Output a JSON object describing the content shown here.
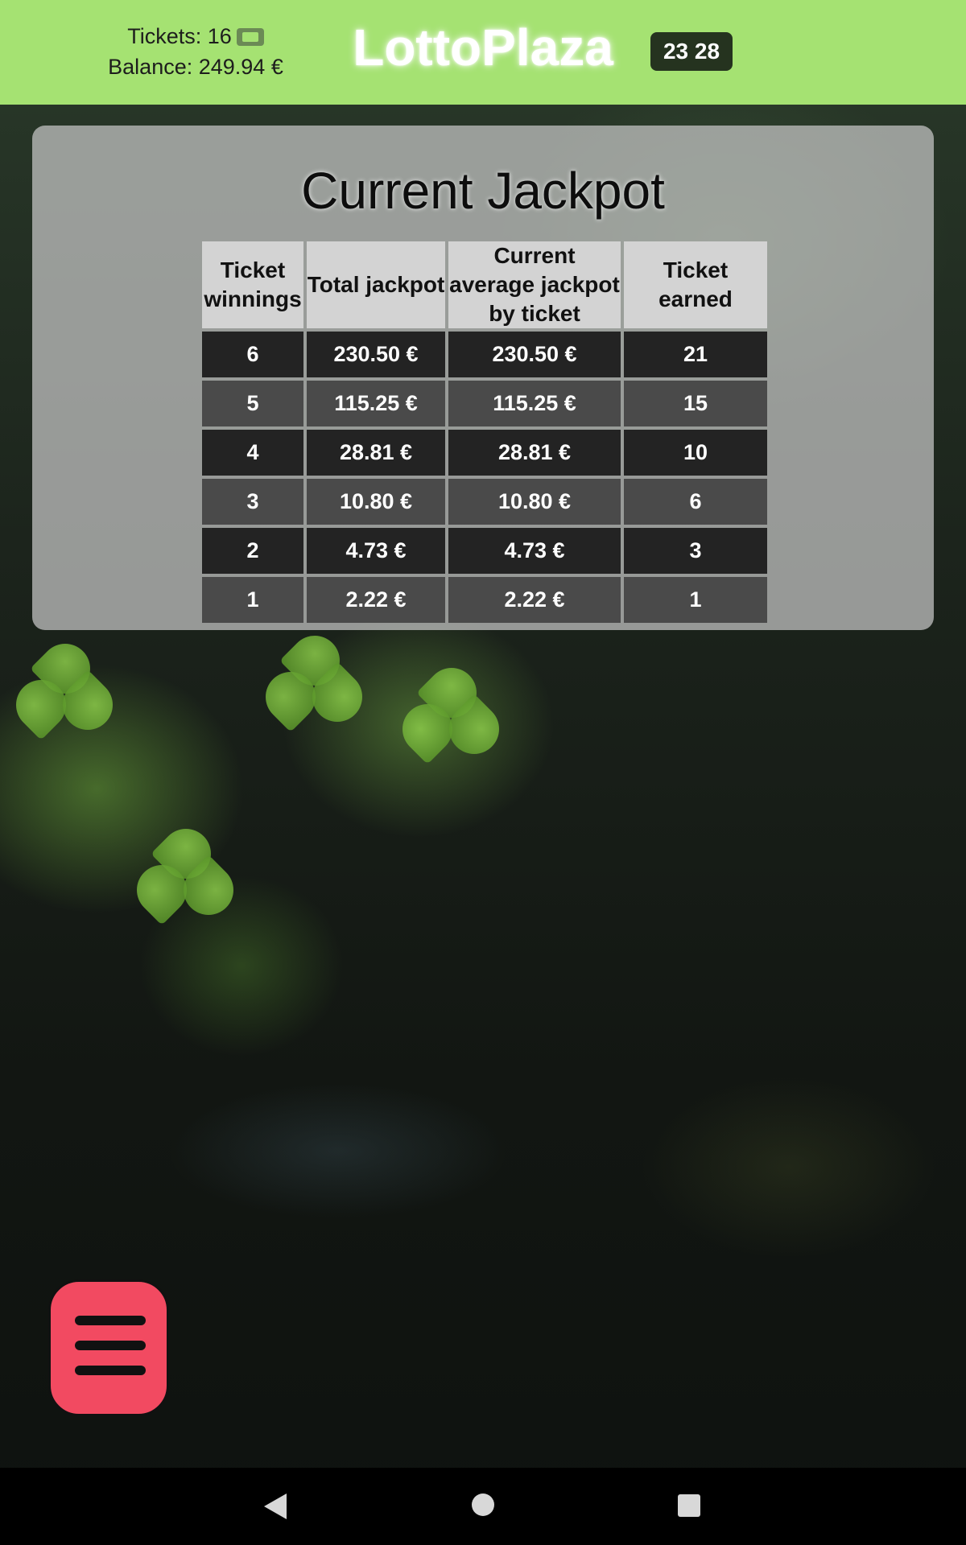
{
  "header": {
    "tickets_label": "Tickets: 16",
    "balance_label": "Balance: 249.94 €",
    "logo": "LottoPlaza",
    "timer": "23 28",
    "background_color": "#a5e272"
  },
  "jackpot": {
    "title": "Current Jackpot",
    "columns": [
      "Ticket winnings",
      "Total jackpot",
      "Current average jackpot by ticket",
      "Ticket earned"
    ],
    "rows": [
      [
        "6",
        "230.50 €",
        "230.50 €",
        "21"
      ],
      [
        "5",
        "115.25 €",
        "115.25 €",
        "15"
      ],
      [
        "4",
        "28.81 €",
        "28.81 €",
        "10"
      ],
      [
        "3",
        "10.80 €",
        "10.80 €",
        "6"
      ],
      [
        "2",
        "4.73 €",
        "4.73 €",
        "3"
      ],
      [
        "1",
        "2.22 €",
        "2.22 €",
        "1"
      ]
    ]
  },
  "menu_button": {
    "icon": "hamburger-menu-icon",
    "color": "#f24a61"
  },
  "system_nav": {
    "back_icon": "back-icon",
    "home_icon": "home-icon",
    "recents_icon": "recents-icon"
  }
}
